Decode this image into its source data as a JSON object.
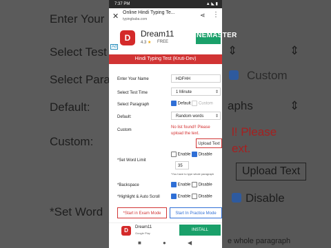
{
  "background": {
    "left": {
      "labels": [
        "Enter Your",
        "Select Test",
        "Select Para",
        "Default:",
        "Custom:",
        "*Set Word"
      ]
    },
    "right": {
      "custom_label": "Custom",
      "paragraph_fragment": "aphs",
      "error_line1": "l! Please",
      "error_line2": "ext.",
      "upload_label": "Upload Text",
      "disable_label": "Disable",
      "hint_fragment": "e whole paragraph"
    }
  },
  "status_bar": {
    "time": "7:37 PM",
    "icons": "▲ ◣ ▮"
  },
  "browser": {
    "title": "Online Hindi Typing Te...",
    "url": "typingbaba.com",
    "close_glyph": "✕",
    "share_glyph": "⋖",
    "menu_glyph": "⋮"
  },
  "top_ad": {
    "app_name": "Dream11",
    "rating": "4.3",
    "star_glyph": "★",
    "price": "FREE",
    "ad_marker": "Ad",
    "logo_glyph": "D"
  },
  "watermark": "INEMASTER",
  "header": {
    "title": "Hindi Typing Test (Kruti-Dev)"
  },
  "form": {
    "name_label": "Enter Your Name",
    "name_value": "HDFHH",
    "time_label": "Select Test Time",
    "time_value": "1 Minute",
    "paragraph_label": "Select Paragraph",
    "paragraph_default": "Default",
    "paragraph_custom": "Custom",
    "default_label": "Default:",
    "default_value": "Random words",
    "custom_label": "Custom",
    "error_text": "No list found!! Please upload the text.",
    "upload_label": "Upload Text",
    "word_limit_label": "*Set Word Limit",
    "enable_label": "Enable",
    "disable_label": "Disable",
    "word_limit_value": "35",
    "word_limit_hint": "*You have to type whole paragraph",
    "backspace_label": "*Backspace",
    "highlight_label": "*Highlight & Auto Scroll",
    "dropdown_arrow": "⇕",
    "exam_button": "*Start in Exam Mode",
    "practice_button": "Start In Practice Mode"
  },
  "bottom_ad": {
    "app_name": "Dream11",
    "source": "Google Play",
    "install_label": "INSTALL",
    "logo_glyph": "D"
  },
  "navbar": {
    "square": "■",
    "home": "●",
    "back": "◀"
  }
}
